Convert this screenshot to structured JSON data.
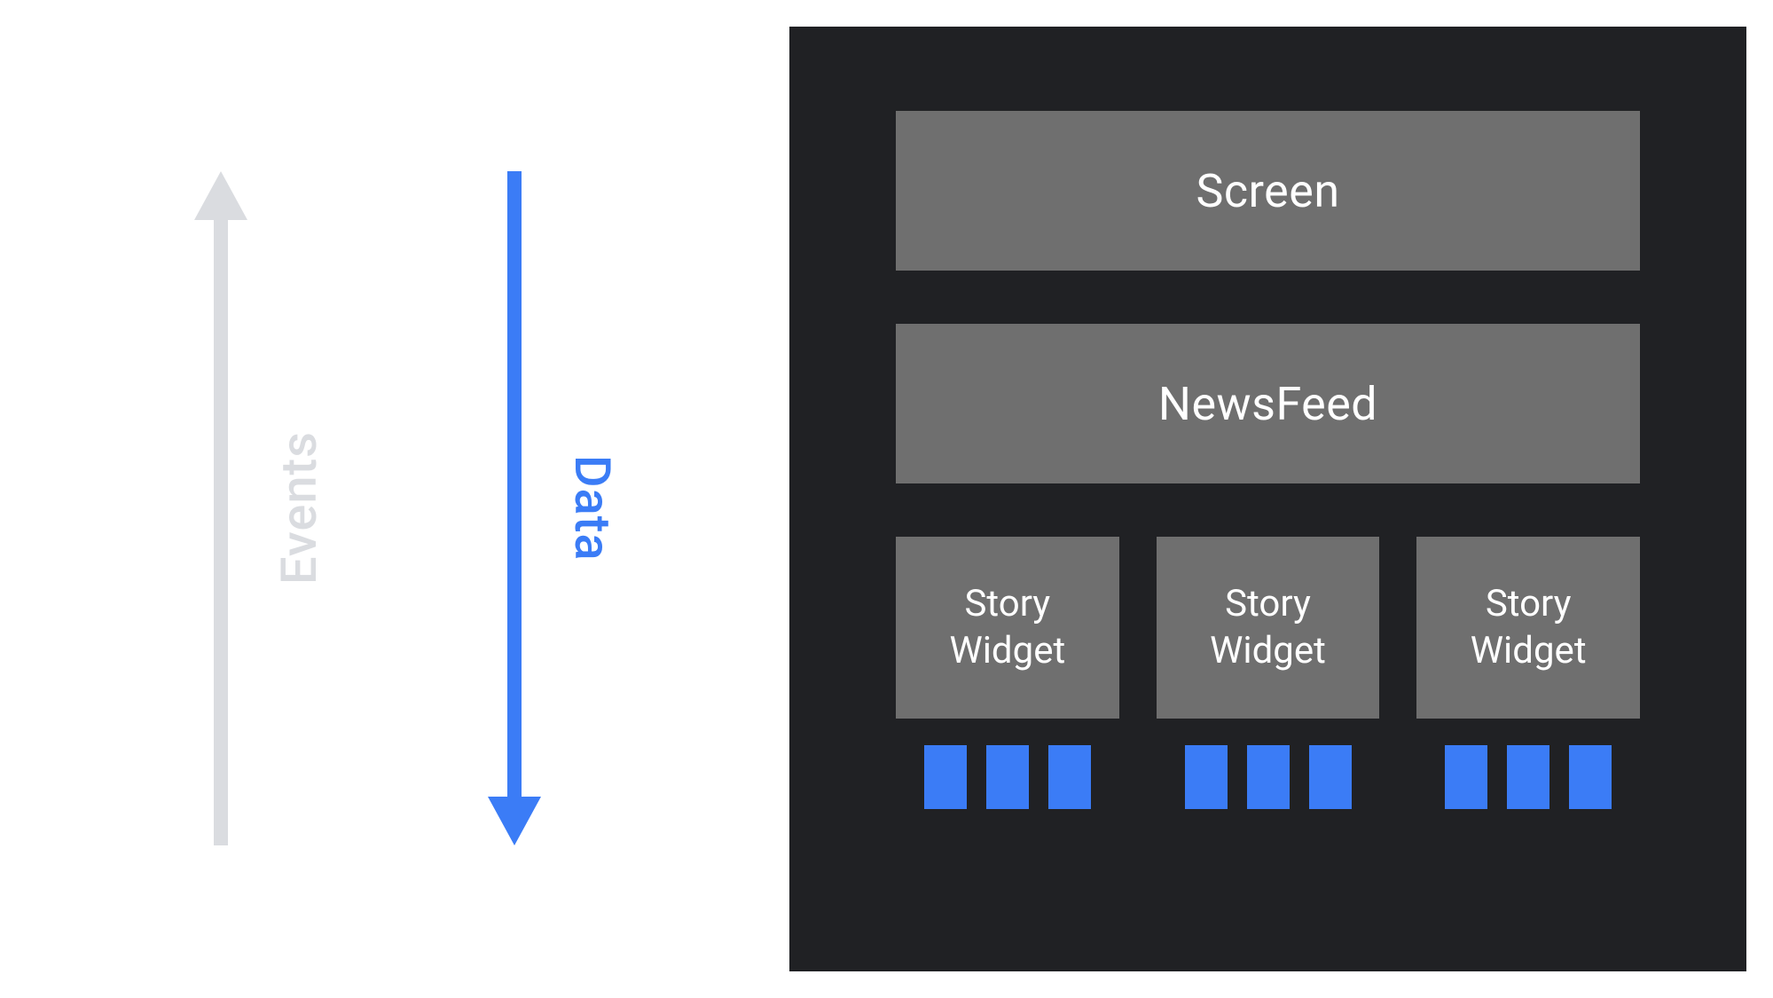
{
  "left": {
    "events_label": "Events",
    "data_label": "Data",
    "colors": {
      "events": "#dadce0",
      "data": "#3b7cf6"
    }
  },
  "right": {
    "screen_label": "Screen",
    "newsfeed_label": "NewsFeed",
    "story_widgets": [
      {
        "label": "Story\nWidget",
        "blue_count": 3
      },
      {
        "label": "Story\nWidget",
        "blue_count": 3
      },
      {
        "label": "Story\nWidget",
        "blue_count": 3
      }
    ],
    "colors": {
      "background": "#202124",
      "box": "#6f6f6f",
      "accent": "#3b7cf6"
    }
  }
}
